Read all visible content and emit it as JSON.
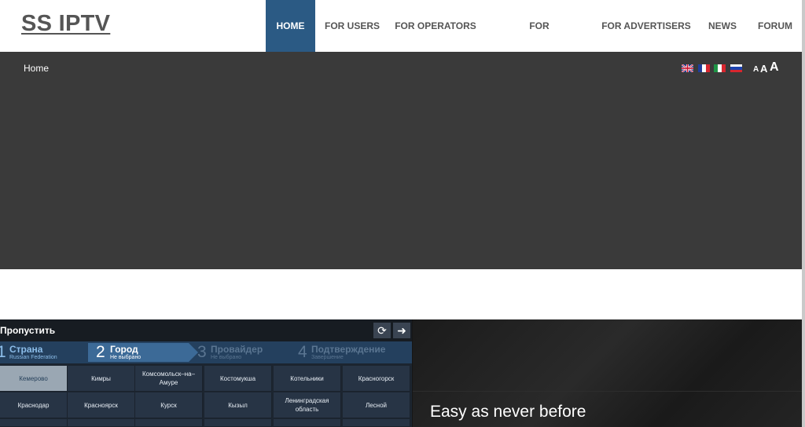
{
  "site": {
    "logo": "SS IPTV"
  },
  "nav": [
    {
      "label": "HOME",
      "active": true
    },
    {
      "label": "FOR USERS"
    },
    {
      "label": "FOR OPERATORS"
    },
    {
      "label": "FOR BROADCASTERS"
    },
    {
      "label": "FOR ADVERTISERS"
    },
    {
      "label": "NEWS"
    },
    {
      "label": "FORUM"
    }
  ],
  "breadcrumb": "Home",
  "languages": [
    "English",
    "French",
    "Italian",
    "Russian"
  ],
  "font_sizes": [
    "A",
    "A",
    "A"
  ],
  "app": {
    "skip_label": "Пропустить",
    "steps": [
      {
        "num": "1",
        "title": "Страна",
        "sub": "Russian Federation",
        "state": "done"
      },
      {
        "num": "2",
        "title": "Город",
        "sub": "Не выбрано",
        "state": "active"
      },
      {
        "num": "3",
        "title": "Провайдер",
        "sub": "Не выбрано",
        "state": "pending"
      },
      {
        "num": "4",
        "title": "Подтверждение",
        "sub": "Завершение",
        "state": "pending"
      }
    ],
    "cities": [
      [
        "Кемерово",
        "Кимры",
        "Комсомольск–на–Амуре",
        "Костомукша",
        "Котельники",
        "Красногорск"
      ],
      [
        "Краснодар",
        "Красноярск",
        "Курск",
        "Кызыл",
        "Ленинградская область",
        "Лесной"
      ]
    ],
    "selected_city": "Кемерово"
  },
  "promo": {
    "tagline": "Easy as never before"
  }
}
